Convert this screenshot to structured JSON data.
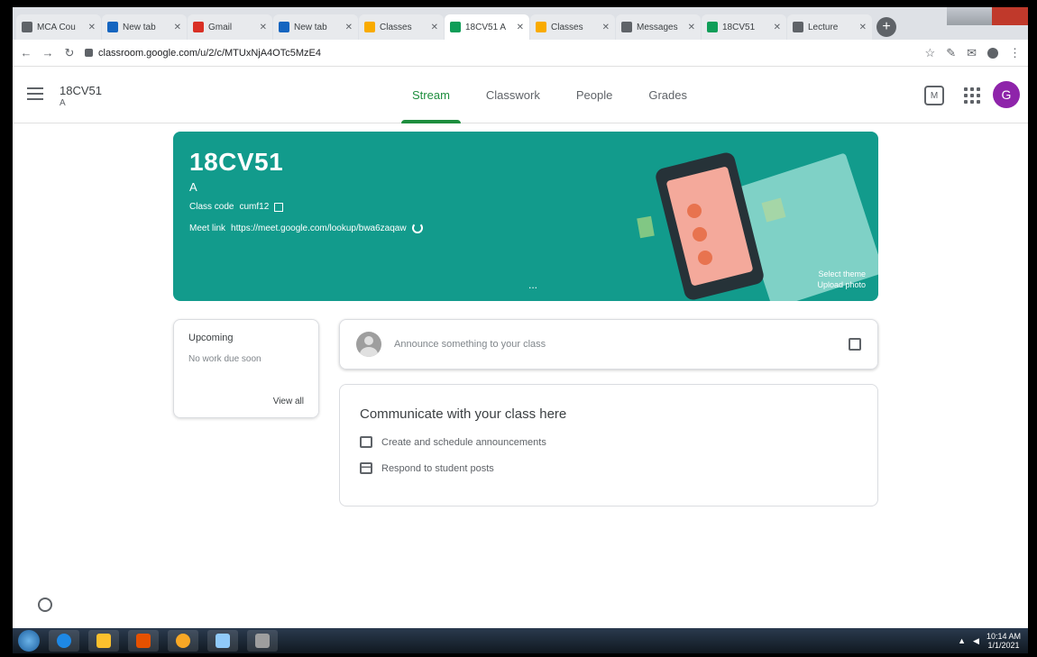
{
  "browser": {
    "tabs": [
      {
        "title": "MCA Cou",
        "color": "#5f6368",
        "active": false
      },
      {
        "title": "New tab",
        "color": "#1565c0",
        "active": false
      },
      {
        "title": "Gmail",
        "color": "#d93025",
        "active": false
      },
      {
        "title": "New tab",
        "color": "#1565c0",
        "active": false
      },
      {
        "title": "Classes",
        "color": "#f9ab00",
        "active": false
      },
      {
        "title": "18CV51 A",
        "color": "#0f9d58",
        "active": true
      },
      {
        "title": "Classes",
        "color": "#f9ab00",
        "active": false
      },
      {
        "title": "Messages",
        "color": "#5f6368",
        "active": false
      },
      {
        "title": "18CV51",
        "color": "#0f9d58",
        "active": false
      },
      {
        "title": "Lecture",
        "color": "#5f6368",
        "active": false
      }
    ],
    "url": "classroom.google.com/u/2/c/MTUxNjA4OTc5MzE4",
    "new_tab_label": "+"
  },
  "header": {
    "class_name": "18CV51",
    "class_section": "A",
    "tabs": [
      "Stream",
      "Classwork",
      "People",
      "Grades"
    ],
    "active_tab": 0,
    "avatar_letter": "G",
    "meet_label": "M"
  },
  "banner": {
    "title": "18CV51",
    "section": "A",
    "class_code_label": "Class code",
    "class_code": "cumf12",
    "meet_link_label": "Meet link",
    "meet_link": "https://meet.google.com/lookup/bwa6zaqaw",
    "ellipsis": "...",
    "theme_line1": "Select theme",
    "theme_line2": "Upload photo",
    "color": "#129b8c"
  },
  "upcoming": {
    "heading": "Upcoming",
    "empty_text": "No work due soon",
    "view_all": "View all"
  },
  "announce": {
    "placeholder": "Announce something to your class"
  },
  "communicate": {
    "heading": "Communicate with your class here",
    "items": [
      "Create and schedule announcements",
      "Respond to student posts"
    ]
  },
  "taskbar": {
    "time": "10:14 AM",
    "date": "1/1/2021"
  }
}
